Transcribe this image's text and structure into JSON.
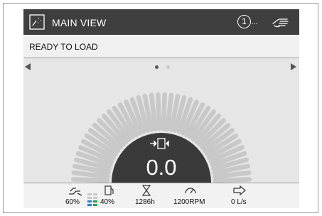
{
  "header": {
    "title": "MAIN VIEW",
    "alarm_count": "1",
    "alarm_more": "...",
    "title_icon": "view-icon",
    "hand_icon": "manual-mode-icon"
  },
  "status": {
    "text": "READY TO LOAD"
  },
  "pager": {
    "current_page": 1,
    "total_pages": 2
  },
  "gauge": {
    "value": "0.0",
    "level": 0,
    "icon": "load-position-icon"
  },
  "bottom": {
    "loader_pct": "60%",
    "fuel_pct": "40%",
    "hours": "1286h",
    "rpm": "1200RPM",
    "flow": "0 L/s"
  },
  "colors": {
    "title_bg": "#3f3f3f",
    "gauge_dark": "#3a3a3a",
    "ticks": "#c8c8c8",
    "level_bars": "#2a7fd4",
    "level_green": "#2fa04a"
  }
}
